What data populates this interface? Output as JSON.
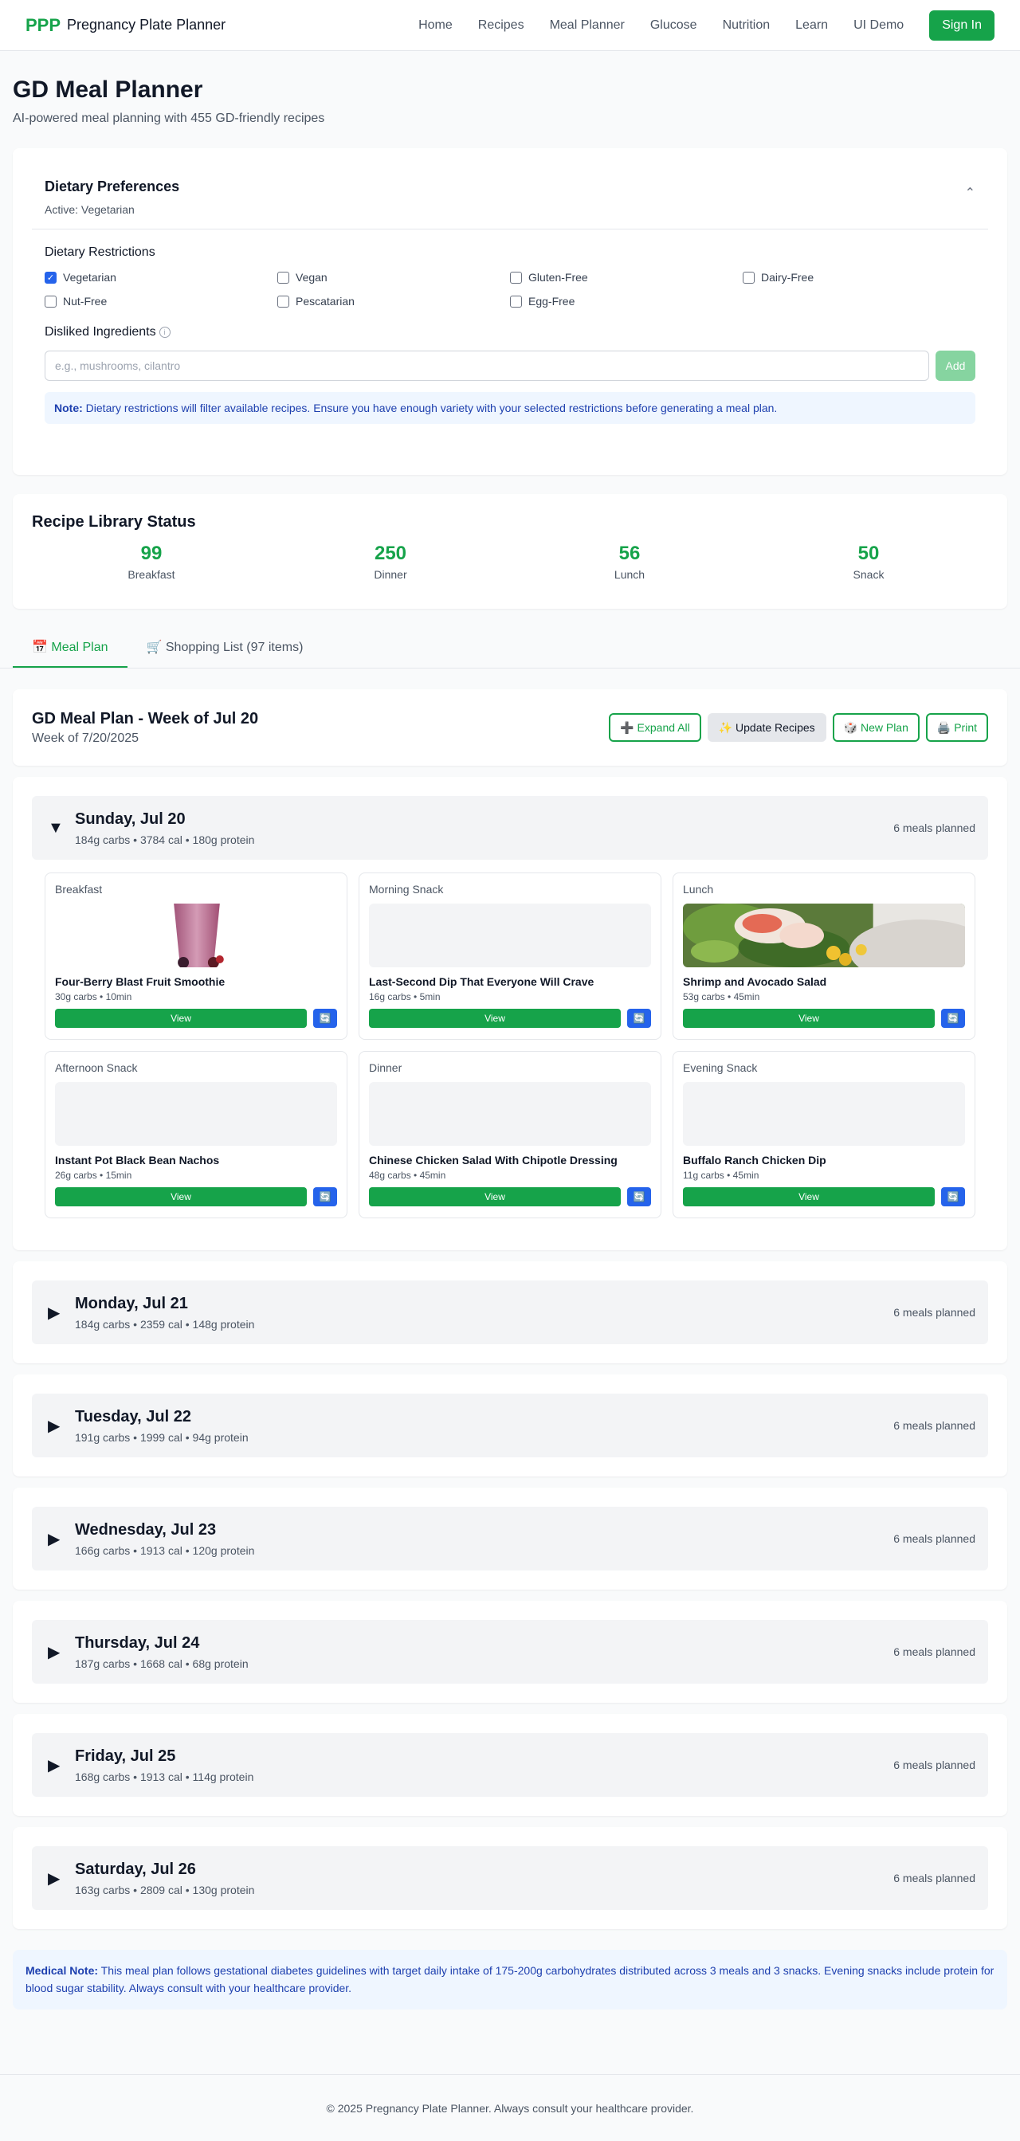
{
  "nav": {
    "logo": "PPP",
    "brand": "Pregnancy Plate Planner",
    "links": [
      "Home",
      "Recipes",
      "Meal Planner",
      "Glucose",
      "Nutrition",
      "Learn",
      "UI Demo"
    ],
    "signin": "Sign In"
  },
  "page": {
    "title": "GD Meal Planner",
    "subtitle": "AI-powered meal planning with 455 GD-friendly recipes"
  },
  "prefs": {
    "title": "Dietary Preferences",
    "active": "Active: Vegetarian",
    "restrictions_label": "Dietary Restrictions",
    "restrictions": [
      {
        "label": "Vegetarian",
        "checked": true
      },
      {
        "label": "Vegan",
        "checked": false
      },
      {
        "label": "Gluten-Free",
        "checked": false
      },
      {
        "label": "Dairy-Free",
        "checked": false
      },
      {
        "label": "Nut-Free",
        "checked": false
      },
      {
        "label": "Pescatarian",
        "checked": false
      },
      {
        "label": "Egg-Free",
        "checked": false
      }
    ],
    "disliked_label": "Disliked Ingredients",
    "disliked_placeholder": "e.g., mushrooms, cilantro",
    "add": "Add",
    "note_bold": "Note:",
    "note_text": " Dietary restrictions will filter available recipes. Ensure you have enough variety with your selected restrictions before generating a meal plan."
  },
  "library": {
    "title": "Recipe Library Status",
    "stats": [
      {
        "value": "99",
        "label": "Breakfast"
      },
      {
        "value": "250",
        "label": "Dinner"
      },
      {
        "value": "56",
        "label": "Lunch"
      },
      {
        "value": "50",
        "label": "Snack"
      }
    ]
  },
  "tabs": [
    "📅 Meal Plan",
    "🛒 Shopping List (97 items)"
  ],
  "plan": {
    "title": "GD Meal Plan - Week of Jul 20",
    "week": "Week of 7/20/2025",
    "actions": [
      "➕ Expand All",
      "✨ Update Recipes",
      "🎲 New Plan",
      "🖨️ Print"
    ]
  },
  "days": [
    {
      "name": "Sunday, Jul 20",
      "stats": "184g carbs • 3784 cal • 180g protein",
      "count": "6 meals planned",
      "expanded": true,
      "meals": [
        {
          "type": "Breakfast",
          "name": "Four-Berry Blast Fruit Smoothie",
          "meta": "30g carbs • 10min",
          "image": "smoothie"
        },
        {
          "type": "Morning Snack",
          "name": "Last-Second Dip That Everyone Will Crave",
          "meta": "16g carbs • 5min",
          "image": "none"
        },
        {
          "type": "Lunch",
          "name": "Shrimp and Avocado Salad",
          "meta": "53g carbs • 45min",
          "image": "salad"
        },
        {
          "type": "Afternoon Snack",
          "name": "Instant Pot Black Bean Nachos",
          "meta": "26g carbs • 15min",
          "image": "none"
        },
        {
          "type": "Dinner",
          "name": "Chinese Chicken Salad With Chipotle Dressing",
          "meta": "48g carbs • 45min",
          "image": "none"
        },
        {
          "type": "Evening Snack",
          "name": "Buffalo Ranch Chicken Dip",
          "meta": "11g carbs • 45min",
          "image": "none"
        }
      ],
      "view": "View",
      "swap": "🔄"
    },
    {
      "name": "Monday, Jul 21",
      "stats": "184g carbs • 2359 cal • 148g protein",
      "count": "6 meals planned"
    },
    {
      "name": "Tuesday, Jul 22",
      "stats": "191g carbs • 1999 cal • 94g protein",
      "count": "6 meals planned"
    },
    {
      "name": "Wednesday, Jul 23",
      "stats": "166g carbs • 1913 cal • 120g protein",
      "count": "6 meals planned"
    },
    {
      "name": "Thursday, Jul 24",
      "stats": "187g carbs • 1668 cal • 68g protein",
      "count": "6 meals planned"
    },
    {
      "name": "Friday, Jul 25",
      "stats": "168g carbs • 1913 cal • 114g protein",
      "count": "6 meals planned"
    },
    {
      "name": "Saturday, Jul 26",
      "stats": "163g carbs • 2809 cal • 130g protein",
      "count": "6 meals planned"
    }
  ],
  "medical": {
    "bold": "Medical Note:",
    "text": " This meal plan follows gestational diabetes guidelines with target daily intake of 175-200g carbohydrates distributed across 3 meals and 3 snacks. Evening snacks include protein for blood sugar stability. Always consult with your healthcare provider."
  },
  "footer": "© 2025 Pregnancy Plate Planner. Always consult your healthcare provider.",
  "colors": {
    "primary": "#16a34a",
    "accent_blue": "#2563eb",
    "note_bg": "#eff6ff"
  }
}
